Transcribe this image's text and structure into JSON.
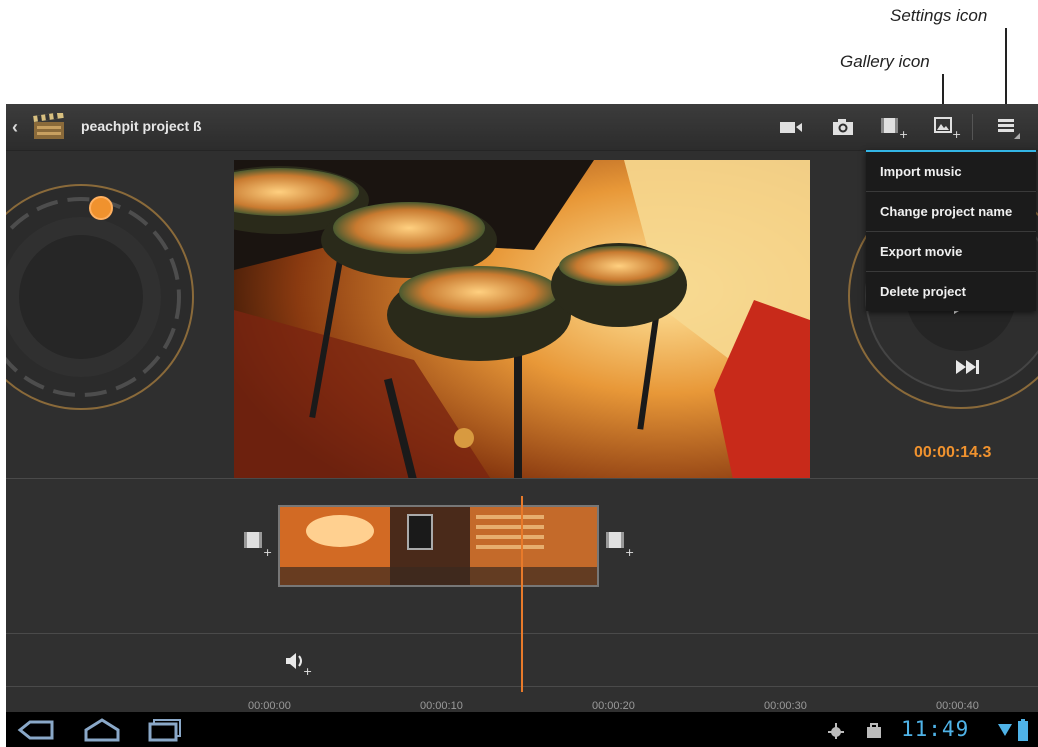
{
  "callouts": {
    "settings": "Settings icon",
    "gallery": "Gallery icon"
  },
  "header": {
    "project_title": "peachpit project ß",
    "icons": [
      "back-chevron-icon",
      "movie-clapper-icon",
      "video-camera-icon",
      "camera-icon",
      "add-video-clip-icon",
      "gallery-icon",
      "settings-menu-icon"
    ]
  },
  "menu": {
    "items": [
      {
        "label": "Import music"
      },
      {
        "label": "Change project name"
      },
      {
        "label": "Export movie"
      },
      {
        "label": "Delete project"
      }
    ]
  },
  "playback": {
    "timecode": "00:00:14.3"
  },
  "timeline": {
    "ruler": [
      "00:00:00",
      "00:00:10",
      "00:00:20",
      "00:00:30",
      "00:00:40"
    ]
  },
  "system_bar": {
    "clock": "11:49",
    "icons": [
      "back-nav-icon",
      "home-nav-icon",
      "recent-apps-icon",
      "debug-icon",
      "shopping-bag-icon",
      "wifi-icon",
      "battery-icon"
    ]
  },
  "colors": {
    "accent": "#f0922e",
    "menu_highlight": "#33b5e5",
    "clock": "#4fb3e8"
  }
}
